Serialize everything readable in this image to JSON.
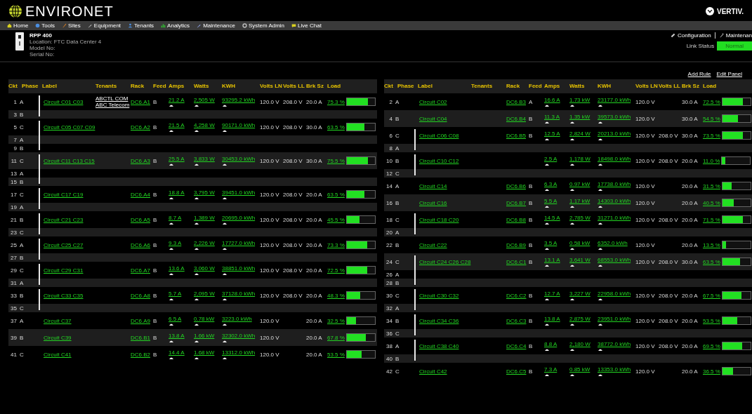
{
  "header": {
    "logo": "ENVIRONET",
    "brand": "VERTIV."
  },
  "nav": [
    "Home",
    "Tools",
    "Sites",
    "Equipment",
    "Tenants",
    "Analytics",
    "Maintenance",
    "System Admin",
    "Live Chat"
  ],
  "device": {
    "name": "RPP 400",
    "lines": [
      "Location: FTC Data Center 4",
      "Model No:",
      "Serial No:"
    ]
  },
  "device_links": [
    "Configuration",
    "Maintenan"
  ],
  "link_status": {
    "label": "Link Status",
    "value": "Normal"
  },
  "actions": [
    "Add Rule",
    "Edit Panel"
  ],
  "panels": [
    {
      "columns": [
        "Ckt",
        "Phase",
        "Label",
        "Tenants",
        "Rack",
        "Feed",
        "Amps",
        "Watts",
        "KWH",
        "Volts LN",
        "Volts LL",
        "Brk Sz",
        "Load"
      ],
      "rows": [
        {
          "ckt": "1",
          "phase": "A",
          "label": "Circuit C01 C03",
          "tenants": "ABCTL COM ABC Telecom",
          "rack": "DC6.A1",
          "feed": "B",
          "amps": "21.2 A",
          "watts": "2,505 W",
          "kwh": "93295.2 kWh",
          "volts_ln": "120.0 V",
          "volts_ll": "208.0 V",
          "brk": "20.0 A",
          "load": "75.3 %",
          "level": 0.753,
          "poles": [
            {
              "ckt": "3",
              "phase": "B"
            }
          ]
        },
        {
          "ckt": "5",
          "phase": "C",
          "label": "Circuit C05 C07 C09",
          "rack": "DC6.A2",
          "feed": "B",
          "amps": "21.5 A",
          "watts": "4,258 W",
          "kwh": "90171.0 kWh",
          "volts_ln": "120.0 V",
          "volts_ll": "208.0 V",
          "brk": "30.0 A",
          "load": "63.5 %",
          "level": 0.635,
          "poles": [
            {
              "ckt": "7",
              "phase": "A"
            },
            {
              "ckt": "9",
              "phase": "B"
            }
          ]
        },
        {
          "ckt": "11",
          "phase": "C",
          "label": "Circuit C11 C13 C15",
          "rack": "DC6.A3",
          "feed": "B",
          "amps": "25.5 A",
          "watts": "3,833 W",
          "kwh": "30453.0 kWh",
          "volts_ln": "120.0 V",
          "volts_ll": "208.0 V",
          "brk": "30.0 A",
          "load": "75.5 %",
          "level": 0.755,
          "poles": [
            {
              "ckt": "13",
              "phase": "A"
            },
            {
              "ckt": "15",
              "phase": "B"
            }
          ]
        },
        {
          "ckt": "17",
          "phase": "C",
          "label": "Circuit C17 C19",
          "rack": "DC6.A4",
          "feed": "B",
          "amps": "18.8 A",
          "watts": "3,795 W",
          "kwh": "39451.0 kWh",
          "volts_ln": "120.0 V",
          "volts_ll": "208.0 V",
          "brk": "20.0 A",
          "load": "63.5 %",
          "level": 0.635,
          "poles": [
            {
              "ckt": "19",
              "phase": "A"
            }
          ]
        },
        {
          "ckt": "21",
          "phase": "B",
          "label": "Circuit C21 C23",
          "rack": "DC6.A5",
          "feed": "B",
          "amps": "8.7 A",
          "watts": "1,389 W",
          "kwh": "20695.0 kWh",
          "volts_ln": "120.0 V",
          "volts_ll": "208.0 V",
          "brk": "20.0 A",
          "load": "45.5 %",
          "level": 0.455,
          "poles": [
            {
              "ckt": "23",
              "phase": "C"
            }
          ]
        },
        {
          "ckt": "25",
          "phase": "A",
          "label": "Circuit C25 C27",
          "rack": "DC6.A6",
          "feed": "B",
          "amps": "9.3 A",
          "watts": "2,226 W",
          "kwh": "17727.0 kWh",
          "volts_ln": "120.0 V",
          "volts_ll": "208.0 V",
          "brk": "20.0 A",
          "load": "73.3 %",
          "level": 0.733,
          "poles": [
            {
              "ckt": "27",
              "phase": "B"
            }
          ]
        },
        {
          "ckt": "29",
          "phase": "C",
          "label": "Circuit C29 C31",
          "rack": "DC6.A7",
          "feed": "B",
          "amps": "13.6 A",
          "watts": "3,060 W",
          "kwh": "38851.0 kWh",
          "volts_ln": "120.0 V",
          "volts_ll": "208.0 V",
          "brk": "20.0 A",
          "load": "72.5 %",
          "level": 0.725,
          "poles": [
            {
              "ckt": "31",
              "phase": "A"
            }
          ]
        },
        {
          "ckt": "33",
          "phase": "B",
          "label": "Circuit C33 C35",
          "rack": "DC6.A8",
          "feed": "B",
          "amps": "5.7 A",
          "watts": "2,095 W",
          "kwh": "37128.0 kWh",
          "volts_ln": "120.0 V",
          "volts_ll": "208.0 V",
          "brk": "20.0 A",
          "load": "48.3 %",
          "level": 0.483,
          "poles": [
            {
              "ckt": "35",
              "phase": "C"
            }
          ]
        },
        {
          "ckt": "37",
          "phase": "A",
          "label": "Circuit C37",
          "rack": "DC6.A9",
          "feed": "B",
          "amps": "6.5 A",
          "watts": "0.78 kW",
          "kwh": "3223.0 kWh",
          "volts_ln": "120.0 V",
          "brk": "20.0 A",
          "load": "32.5 %",
          "level": 0.325
        },
        {
          "ckt": "39",
          "phase": "B",
          "label": "Circuit C39",
          "rack": "DC6.B1",
          "feed": "B",
          "amps": "13.8 A",
          "watts": "1.66 kW",
          "kwh": "32302.0 kWh",
          "volts_ln": "120.0 V",
          "brk": "20.0 A",
          "load": "67.8 %",
          "level": 0.678
        },
        {
          "ckt": "41",
          "phase": "C",
          "label": "Circuit C41",
          "rack": "DC6.B2",
          "feed": "B",
          "amps": "14.4 A",
          "watts": "1.68 kW",
          "kwh": "13312.0 kWh",
          "volts_ln": "120.0 V",
          "brk": "20.0 A",
          "load": "53.5 %",
          "level": 0.535
        }
      ]
    },
    {
      "columns": [
        "Ckt",
        "Phase",
        "Label",
        "Tenants",
        "Rack",
        "Feed",
        "Amps",
        "Watts",
        "KWH",
        "Volts LN",
        "Volts LL",
        "Brk Sz",
        "Load"
      ],
      "rows": [
        {
          "ckt": "2",
          "phase": "A",
          "label": "Circuit C02",
          "rack": "DC6.B3",
          "feed": "A",
          "amps": "16.6 A",
          "watts": "1.73 kW",
          "kwh": "23177.0 kWh",
          "volts_ln": "120.0 V",
          "brk": "30.0 A",
          "load": "72.5 %",
          "level": 0.725
        },
        {
          "ckt": "4",
          "phase": "B",
          "label": "Circuit C04",
          "rack": "DC6.B4",
          "feed": "B",
          "amps": "11.3 A",
          "watts": "1.35 kW",
          "kwh": "39573.0 kWh",
          "volts_ln": "120.0 V",
          "brk": "30.0 A",
          "load": "54.5 %",
          "level": 0.545
        },
        {
          "ckt": "6",
          "phase": "C",
          "label": "Circuit C06 C08",
          "rack": "DC6.B5",
          "feed": "B",
          "amps": "12.5 A",
          "watts": "2,824 W",
          "kwh": "20213.0 kWh",
          "volts_ln": "120.0 V",
          "volts_ll": "208.0 V",
          "brk": "30.0 A",
          "load": "73.5 %",
          "level": 0.735,
          "poles": [
            {
              "ckt": "8",
              "phase": "A"
            }
          ]
        },
        {
          "ckt": "10",
          "phase": "B",
          "label": "Circuit C10 C12",
          "amps": "2.5 A",
          "watts": "1,178 W",
          "kwh": "18498.0 kWh",
          "volts_ln": "120.0 V",
          "volts_ll": "208.0 V",
          "brk": "20.0 A",
          "load": "11.0 %",
          "level": 0.11,
          "poles": [
            {
              "ckt": "12",
              "phase": "C"
            }
          ]
        },
        {
          "ckt": "14",
          "phase": "A",
          "label": "Circuit C14",
          "rack": "DC6.B6",
          "feed": "B",
          "amps": "6.3 A",
          "watts": "0.97 kW",
          "kwh": "17738.0 kWh",
          "volts_ln": "120.0 V",
          "brk": "20.0 A",
          "load": "31.5 %",
          "level": 0.315
        },
        {
          "ckt": "16",
          "phase": "B",
          "label": "Circuit C16",
          "rack": "DC6.B7",
          "feed": "B",
          "amps": "5.5 A",
          "watts": "1.17 kW",
          "kwh": "14303.0 kWh",
          "volts_ln": "120.0 V",
          "brk": "20.0 A",
          "load": "40.5 %",
          "level": 0.405
        },
        {
          "ckt": "18",
          "phase": "C",
          "label": "Circuit C18 C20",
          "rack": "DC6.B8",
          "feed": "B",
          "amps": "14.5 A",
          "watts": "2,785 W",
          "kwh": "31271.0 kWh",
          "volts_ln": "120.0 V",
          "volts_ll": "208.0 V",
          "brk": "20.0 A",
          "load": "71.5 %",
          "level": 0.715,
          "poles": [
            {
              "ckt": "20",
              "phase": "A"
            }
          ]
        },
        {
          "ckt": "22",
          "phase": "B",
          "label": "Circuit C22",
          "rack": "DC6.B9",
          "feed": "B",
          "amps": "3.5 A",
          "watts": "0.58 kW",
          "kwh": "6352.0 kWh",
          "volts_ln": "120.0 V",
          "brk": "20.0 A",
          "load": "13.5 %",
          "level": 0.135
        },
        {
          "ckt": "24",
          "phase": "C",
          "label": "Circuit C24 C26 C28",
          "rack": "DC6.C1",
          "feed": "B",
          "amps": "13.1 A",
          "watts": "3,641 W",
          "kwh": "68553.0 kWh",
          "volts_ln": "120.0 V",
          "volts_ll": "208.0 V",
          "brk": "30.0 A",
          "load": "63.5 %",
          "level": 0.635,
          "poles": [
            {
              "ckt": "26",
              "phase": "A"
            },
            {
              "ckt": "28",
              "phase": "B"
            }
          ]
        },
        {
          "ckt": "30",
          "phase": "C",
          "label": "Circuit C30 C32",
          "rack": "DC6.C2",
          "feed": "B",
          "amps": "12.7 A",
          "watts": "3,227 W",
          "kwh": "22958.0 kWh",
          "volts_ln": "120.0 V",
          "volts_ll": "208.0 V",
          "brk": "20.0 A",
          "load": "67.5 %",
          "level": 0.675,
          "poles": [
            {
              "ckt": "32",
              "phase": "A"
            }
          ]
        },
        {
          "ckt": "34",
          "phase": "B",
          "label": "Circuit C34 C36",
          "rack": "DC6.C3",
          "feed": "B",
          "amps": "13.8 A",
          "watts": "2,875 W",
          "kwh": "23951.0 kWh",
          "volts_ln": "120.0 V",
          "volts_ll": "208.0 V",
          "brk": "20.0 A",
          "load": "53.5 %",
          "level": 0.535,
          "poles": [
            {
              "ckt": "36",
              "phase": "C"
            }
          ]
        },
        {
          "ckt": "38",
          "phase": "A",
          "label": "Circuit C38 C40",
          "rack": "DC6.C4",
          "feed": "B",
          "amps": "8.8 A",
          "watts": "2,180 W",
          "kwh": "38772.0 kWh",
          "volts_ln": "120.0 V",
          "volts_ll": "208.0 V",
          "brk": "20.0 A",
          "load": "69.5 %",
          "level": 0.695,
          "poles": [
            {
              "ckt": "40",
              "phase": "B"
            }
          ]
        },
        {
          "ckt": "42",
          "phase": "C",
          "label": "Circuit C42",
          "rack": "DC6.C5",
          "feed": "B",
          "amps": "7.3 A",
          "watts": "0.85 kW",
          "kwh": "13353.0 kWh",
          "volts_ln": "120.0 V",
          "brk": "20.0 A",
          "load": "36.5 %",
          "level": 0.365
        }
      ]
    }
  ]
}
